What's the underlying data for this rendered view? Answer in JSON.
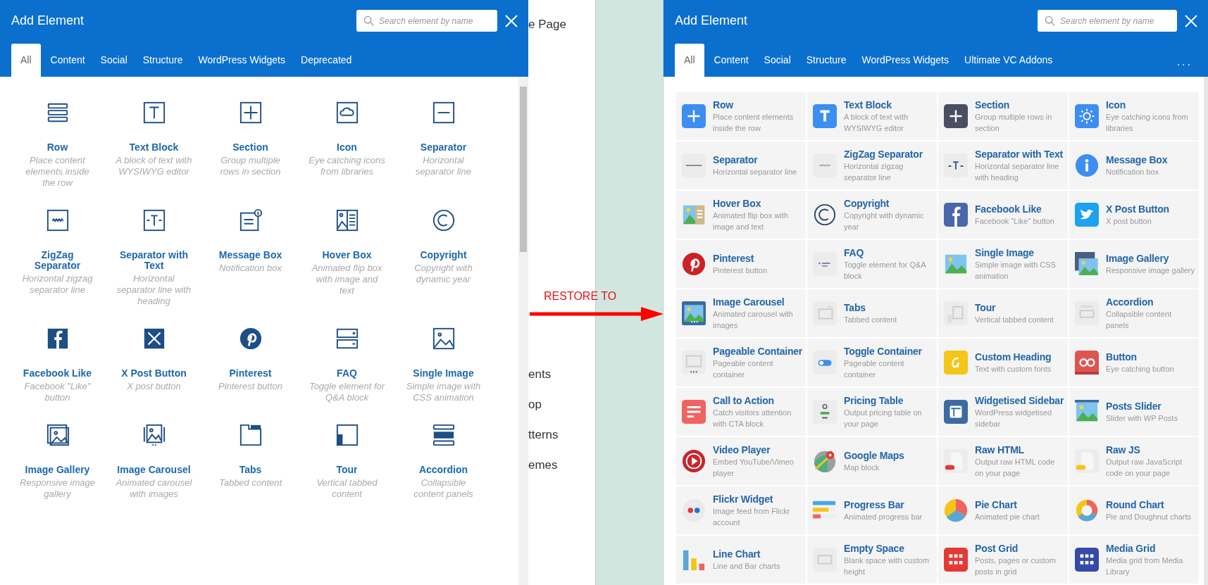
{
  "left_panel": {
    "title": "Add Element",
    "search": {
      "placeholder": "Search element by name"
    },
    "tabs": [
      {
        "label": "All",
        "selected": true
      },
      {
        "label": "Content",
        "selected": false
      },
      {
        "label": "Social",
        "selected": false
      },
      {
        "label": "Structure",
        "selected": false
      },
      {
        "label": "WordPress Widgets",
        "selected": false
      },
      {
        "label": "Deprecated",
        "selected": false
      }
    ],
    "elements": [
      {
        "name": "Row",
        "description": "Place content elements inside the row"
      },
      {
        "name": "Text Block",
        "description": "A block of text with WYSIWYG editor"
      },
      {
        "name": "Section",
        "description": "Group multiple rows in section"
      },
      {
        "name": "Icon",
        "description": "Eye catching icons from libraries"
      },
      {
        "name": "Separator",
        "description": "Horizontal separator line"
      },
      {
        "name": "ZigZag Separator",
        "description": "Horizontal zigzag separator line"
      },
      {
        "name": "Separator with Text",
        "description": "Horizontal separator line with heading"
      },
      {
        "name": "Message Box",
        "description": "Notification box"
      },
      {
        "name": "Hover Box",
        "description": "Animated flip box with image and text"
      },
      {
        "name": "Copyright",
        "description": "Copyright with dynamic year"
      },
      {
        "name": "Facebook Like",
        "description": "Facebook \"Like\" button"
      },
      {
        "name": "X Post Button",
        "description": "X post button"
      },
      {
        "name": "Pinterest",
        "description": "Pinterest button"
      },
      {
        "name": "FAQ",
        "description": "Toggle element for Q&A block"
      },
      {
        "name": "Single Image",
        "description": "Simple image with CSS animation"
      },
      {
        "name": "Image Gallery",
        "description": "Responsive image gallery"
      },
      {
        "name": "Image Carousel",
        "description": "Animated carousel with images"
      },
      {
        "name": "Tabs",
        "description": "Tabbed content"
      },
      {
        "name": "Tour",
        "description": "Vertical tabbed content"
      },
      {
        "name": "Accordion",
        "description": "Collapsible content panels"
      }
    ]
  },
  "background_page": {
    "texts": [
      "e Page",
      "ents",
      "op",
      "tterns",
      "emes"
    ]
  },
  "annotation": {
    "label": "RESTORE TO"
  },
  "right_panel": {
    "title": "Add Element",
    "search": {
      "placeholder": "Search element by name"
    },
    "tabs": [
      {
        "label": "All",
        "selected": true
      },
      {
        "label": "Content",
        "selected": false
      },
      {
        "label": "Social",
        "selected": false
      },
      {
        "label": "Structure",
        "selected": false
      },
      {
        "label": "WordPress Widgets",
        "selected": false
      },
      {
        "label": "Ultimate VC Addons",
        "selected": false
      }
    ],
    "more": "...",
    "elements": [
      {
        "name": "Row",
        "description": "Place content elements inside the row"
      },
      {
        "name": "Text Block",
        "description": "A block of text with WYSIWYG editor"
      },
      {
        "name": "Section",
        "description": "Group multiple rows in section"
      },
      {
        "name": "Icon",
        "description": "Eye catching icons from libraries"
      },
      {
        "name": "Separator",
        "description": "Horizontal separator line"
      },
      {
        "name": "ZigZag Separator",
        "description": "Horizontal zigzag separator line"
      },
      {
        "name": "Separator with Text",
        "description": "Horizontal separator line with heading"
      },
      {
        "name": "Message Box",
        "description": "Notification box"
      },
      {
        "name": "Hover Box",
        "description": "Animated flip box with image and text"
      },
      {
        "name": "Copyright",
        "description": "Copyright with dynamic year"
      },
      {
        "name": "Facebook Like",
        "description": "Facebook \"Like\" button"
      },
      {
        "name": "X Post Button",
        "description": "X post button"
      },
      {
        "name": "Pinterest",
        "description": "Pinterest button"
      },
      {
        "name": "FAQ",
        "description": "Toggle element for Q&A block"
      },
      {
        "name": "Single Image",
        "description": "Simple image with CSS animation"
      },
      {
        "name": "Image Gallery",
        "description": "Responsive image gallery"
      },
      {
        "name": "Image Carousel",
        "description": "Animated carousel with images"
      },
      {
        "name": "Tabs",
        "description": "Tabbed content"
      },
      {
        "name": "Tour",
        "description": "Vertical tabbed content"
      },
      {
        "name": "Accordion",
        "description": "Collapsible content panels"
      },
      {
        "name": "Pageable Container",
        "description": "Pageable content container"
      },
      {
        "name": "Toggle Container",
        "description": "Pageable content container"
      },
      {
        "name": "Custom Heading",
        "description": "Text with custom fonts"
      },
      {
        "name": "Button",
        "description": "Eye catching button"
      },
      {
        "name": "Call to Action",
        "description": "Catch visitors attention with CTA block"
      },
      {
        "name": "Pricing Table",
        "description": "Output pricing table on your page"
      },
      {
        "name": "Widgetised Sidebar",
        "description": "WordPress widgetised sidebar"
      },
      {
        "name": "Posts Slider",
        "description": "Slider with WP Posts"
      },
      {
        "name": "Video Player",
        "description": "Embed YouTube/Vimeo player"
      },
      {
        "name": "Google Maps",
        "description": "Map block"
      },
      {
        "name": "Raw HTML",
        "description": "Output raw HTML code on your page"
      },
      {
        "name": "Raw JS",
        "description": "Output raw JavaScript code on your page"
      },
      {
        "name": "Flickr Widget",
        "description": "Image feed from Flickr account"
      },
      {
        "name": "Progress Bar",
        "description": "Animated progress bar"
      },
      {
        "name": "Pie Chart",
        "description": "Animated pie chart"
      },
      {
        "name": "Round Chart",
        "description": "Pie and Doughnut charts"
      },
      {
        "name": "Line Chart",
        "description": "Line and Bar charts"
      },
      {
        "name": "Empty Space",
        "description": "Blank space with custom height"
      },
      {
        "name": "Post Grid",
        "description": "Posts, pages or custom posts in grid"
      },
      {
        "name": "Media Grid",
        "description": "Media grid from Media Library"
      }
    ]
  }
}
